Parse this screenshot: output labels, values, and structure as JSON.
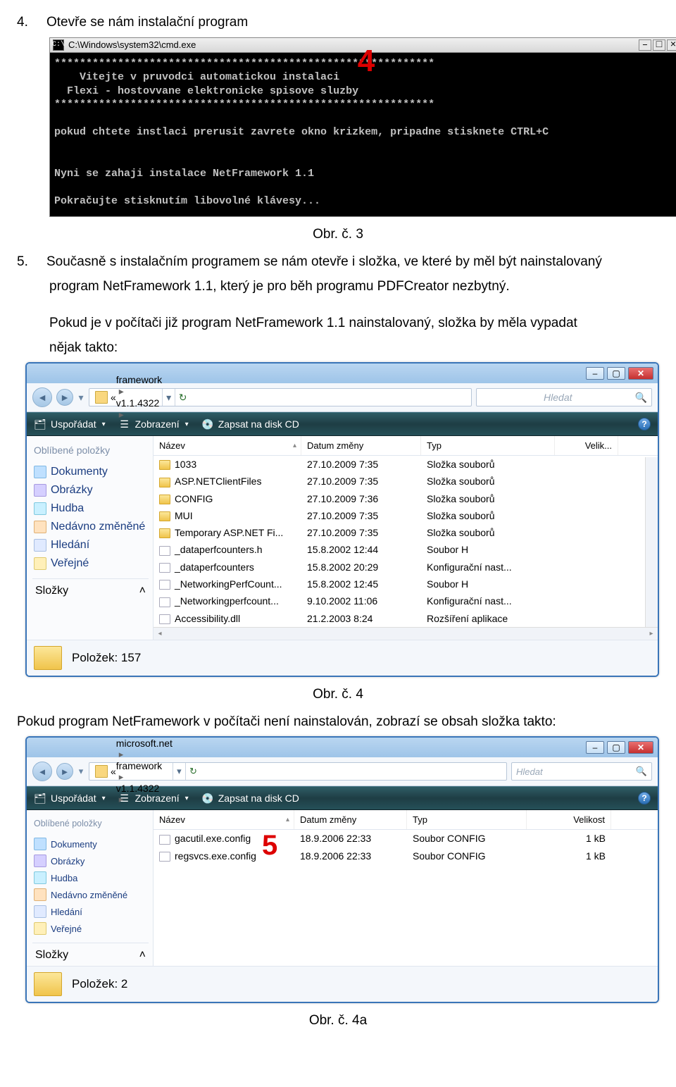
{
  "step4": {
    "num": "4.",
    "text": "Otevře se nám instalační program"
  },
  "cmd": {
    "title": "C:\\Windows\\system32\\cmd.exe",
    "marker": "4",
    "lines": [
      "************************************************************",
      "    Vitejte v pruvodci automatickou instalaci",
      "  Flexi - hostovvane elektronicke spisove sluzby",
      "************************************************************",
      "",
      "pokud chtete instlaci prerusit zavrete okno krizkem, pripadne stisknete CTRL+C",
      "",
      "",
      "Nyni se zahaji instalace NetFramework 1.1",
      "",
      "Pokračujte stisknutím libovolné klávesy..."
    ]
  },
  "caption3": "Obr. č. 3",
  "step5": {
    "num": "5.",
    "line1": "Současně s instalačním programem se nám otevře i složka, ve které by měl být nainstalovaný",
    "line2": "program NetFramework 1.1, který je pro běh programu PDFCreator nezbytný.",
    "line3": "Pokud je v počítači již program NetFramework 1.1 nainstalovaný, složka by měla vypadat",
    "line4": "nějak takto:"
  },
  "explorer1": {
    "breadcrumb_prefix": "«",
    "breadcrumb": [
      "framework",
      "v1.1.4322"
    ],
    "search_placeholder": "Hledat",
    "toolbar": {
      "organise": "Uspořádat",
      "view": "Zobrazení",
      "burn": "Zapsat na disk CD"
    },
    "sidebar_header": "Oblíbené položky",
    "sidebar": [
      {
        "label": "Dokumenty",
        "cls": "ico-doc"
      },
      {
        "label": "Obrázky",
        "cls": "ico-img"
      },
      {
        "label": "Hudba",
        "cls": "ico-music"
      },
      {
        "label": "Nedávno změněné",
        "cls": "ico-recent"
      },
      {
        "label": "Hledání",
        "cls": "ico-search"
      },
      {
        "label": "Veřejné",
        "cls": "ico-public"
      }
    ],
    "sidebar_footer": "Složky",
    "columns": {
      "name": "Název",
      "date": "Datum změny",
      "type": "Typ",
      "size": "Velik..."
    },
    "rows": [
      {
        "icon": "lv-folder",
        "name": "1033",
        "date": "27.10.2009 7:35",
        "type": "Složka souborů",
        "size": ""
      },
      {
        "icon": "lv-folder",
        "name": "ASP.NETClientFiles",
        "date": "27.10.2009 7:35",
        "type": "Složka souborů",
        "size": ""
      },
      {
        "icon": "lv-folder",
        "name": "CONFIG",
        "date": "27.10.2009 7:36",
        "type": "Složka souborů",
        "size": ""
      },
      {
        "icon": "lv-folder",
        "name": "MUI",
        "date": "27.10.2009 7:35",
        "type": "Složka souborů",
        "size": ""
      },
      {
        "icon": "lv-folder",
        "name": "Temporary ASP.NET Fi...",
        "date": "27.10.2009 7:35",
        "type": "Složka souborů",
        "size": ""
      },
      {
        "icon": "lv-file",
        "name": "_dataperfcounters.h",
        "date": "15.8.2002 12:44",
        "type": "Soubor H",
        "size": ""
      },
      {
        "icon": "lv-cfg",
        "name": "_dataperfcounters",
        "date": "15.8.2002 20:29",
        "type": "Konfigurační nast...",
        "size": ""
      },
      {
        "icon": "lv-file",
        "name": "_NetworkingPerfCount...",
        "date": "15.8.2002 12:45",
        "type": "Soubor H",
        "size": ""
      },
      {
        "icon": "lv-cfg",
        "name": "_Networkingperfcount...",
        "date": "9.10.2002 11:06",
        "type": "Konfigurační nast...",
        "size": ""
      },
      {
        "icon": "lv-dll",
        "name": "Accessibility.dll",
        "date": "21.2.2003 8:24",
        "type": "Rozšíření aplikace",
        "size": ""
      }
    ],
    "status": "Položek: 157"
  },
  "caption4": "Obr. č. 4",
  "mid_text": "Pokud program NetFramework v počítači není nainstalován, zobrazí se obsah složka takto:",
  "explorer2": {
    "breadcrumb_prefix": "«",
    "breadcrumb": [
      "microsoft.net",
      "framework",
      "v1.1.4322"
    ],
    "search_placeholder": "Hledat",
    "toolbar": {
      "organise": "Uspořádat",
      "view": "Zobrazení",
      "burn": "Zapsat na disk CD"
    },
    "sidebar_header": "Oblíbené položky",
    "sidebar": [
      {
        "label": "Dokumenty",
        "cls": "ico-doc"
      },
      {
        "label": "Obrázky",
        "cls": "ico-img"
      },
      {
        "label": "Hudba",
        "cls": "ico-music"
      },
      {
        "label": "Nedávno změněné",
        "cls": "ico-recent"
      },
      {
        "label": "Hledání",
        "cls": "ico-search"
      },
      {
        "label": "Veřejné",
        "cls": "ico-public"
      }
    ],
    "sidebar_footer": "Složky",
    "columns": {
      "name": "Název",
      "date": "Datum změny",
      "type": "Typ",
      "size": "Velikost"
    },
    "rows": [
      {
        "icon": "lv-file",
        "name": "gacutil.exe.config",
        "date": "18.9.2006 22:33",
        "type": "Soubor CONFIG",
        "size": "1 kB"
      },
      {
        "icon": "lv-file",
        "name": "regsvcs.exe.config",
        "date": "18.9.2006 22:33",
        "type": "Soubor CONFIG",
        "size": "1 kB"
      }
    ],
    "status": "Položek: 2",
    "marker": "5"
  },
  "caption4a": "Obr. č. 4a"
}
